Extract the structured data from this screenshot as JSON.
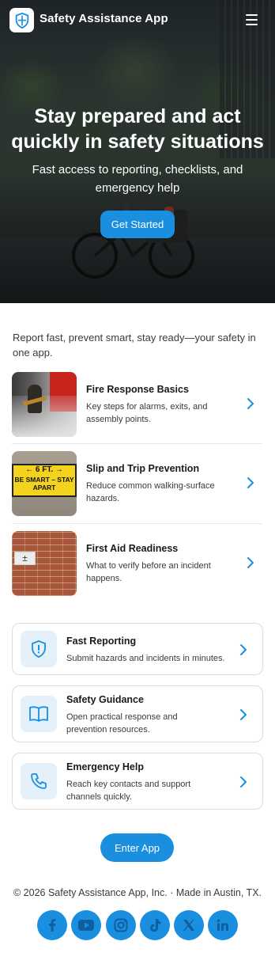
{
  "header": {
    "brand": "Safety Assistance App",
    "logo_icon": "shield-icon",
    "menu_icon": "hamburger-menu-icon"
  },
  "hero": {
    "title": "Stay prepared and act quickly in safety situations",
    "subtitle": "Fast access to reporting, checklists, and emergency help",
    "cta": "Get Started"
  },
  "intro": "Report fast, prevent smart, stay ready—your safety in one app.",
  "articles": [
    {
      "title": "Fire Response Basics",
      "desc": "Key steps for alarms, exits, and assembly points."
    },
    {
      "title": "Slip and Trip Prevention",
      "desc": "Reduce common walking-surface hazards.",
      "sign_line1": "← 6 FT. →",
      "sign_line2": "BE SMART – STAY APART"
    },
    {
      "title": "First Aid Readiness",
      "desc": "What to verify before an incident happens.",
      "box_text": "±"
    }
  ],
  "features": [
    {
      "title": "Fast Reporting",
      "desc": "Submit hazards and incidents in minutes.",
      "icon": "alert-shield-icon"
    },
    {
      "title": "Safety Guidance",
      "desc": "Open practical response and prevention resources.",
      "icon": "book-icon"
    },
    {
      "title": "Emergency Help",
      "desc": "Reach key contacts and support channels quickly.",
      "icon": "phone-icon"
    }
  ],
  "enter_app": "Enter App",
  "footer": "© 2026 Safety Assistance App, Inc. · Made in Austin, TX.",
  "social": [
    "facebook-icon",
    "youtube-icon",
    "instagram-icon",
    "tiktok-icon",
    "x-icon",
    "linkedin-icon"
  ],
  "colors": {
    "accent": "#1a8fe0",
    "icon_bg": "#e4f1fb"
  }
}
